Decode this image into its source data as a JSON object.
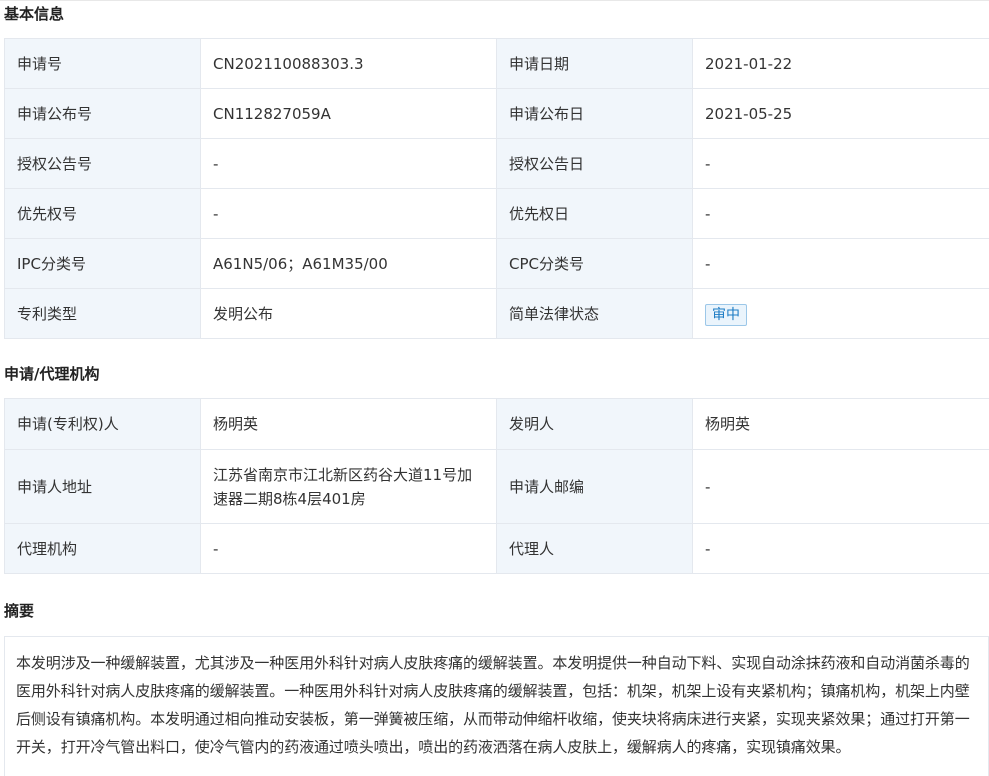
{
  "basic": {
    "title": "基本信息",
    "rows": [
      [
        "申请号",
        "CN202110088303.3",
        "申请日期",
        "2021-01-22"
      ],
      [
        "申请公布号",
        "CN112827059A",
        "申请公布日",
        "2021-05-25"
      ],
      [
        "授权公告号",
        "-",
        "授权公告日",
        "-"
      ],
      [
        "优先权号",
        "-",
        "优先权日",
        "-"
      ],
      [
        "IPC分类号",
        "A61N5/06；A61M35/00",
        "CPC分类号",
        "-"
      ],
      [
        "专利类型",
        "发明公布",
        "简单法律状态",
        "审中"
      ]
    ]
  },
  "agency": {
    "title": "申请/代理机构",
    "rows": [
      [
        "申请(专利权)人",
        "杨明英",
        "发明人",
        "杨明英"
      ],
      [
        "申请人地址",
        "江苏省南京市江北新区药谷大道11号加速器二期8栋4层401房",
        "申请人邮编",
        "-"
      ],
      [
        "代理机构",
        "-",
        "代理人",
        "-"
      ]
    ]
  },
  "abstract": {
    "title": "摘要",
    "text": "本发明涉及一种缓解装置，尤其涉及一种医用外科针对病人皮肤疼痛的缓解装置。本发明提供一种自动下料、实现自动涂抹药液和自动消菌杀毒的医用外科针对病人皮肤疼痛的缓解装置。一种医用外科针对病人皮肤疼痛的缓解装置，包括：机架，机架上设有夹紧机构；镇痛机构，机架上内壁后侧设有镇痛机构。本发明通过相向推动安装板，第一弹簧被压缩，从而带动伸缩杆收缩，使夹块将病床进行夹紧，实现夹紧效果；通过打开第一开关，打开冷气管出料口，使冷气管内的药液通过喷头喷出，喷出的药液洒落在病人皮肤上，缓解病人的疼痛，实现镇痛效果。"
  },
  "colors": {
    "label_bg": "#f1f6fb",
    "border": "#e4e8ee",
    "badge_text": "#1c7bc4",
    "badge_border": "#9cc7e8"
  }
}
